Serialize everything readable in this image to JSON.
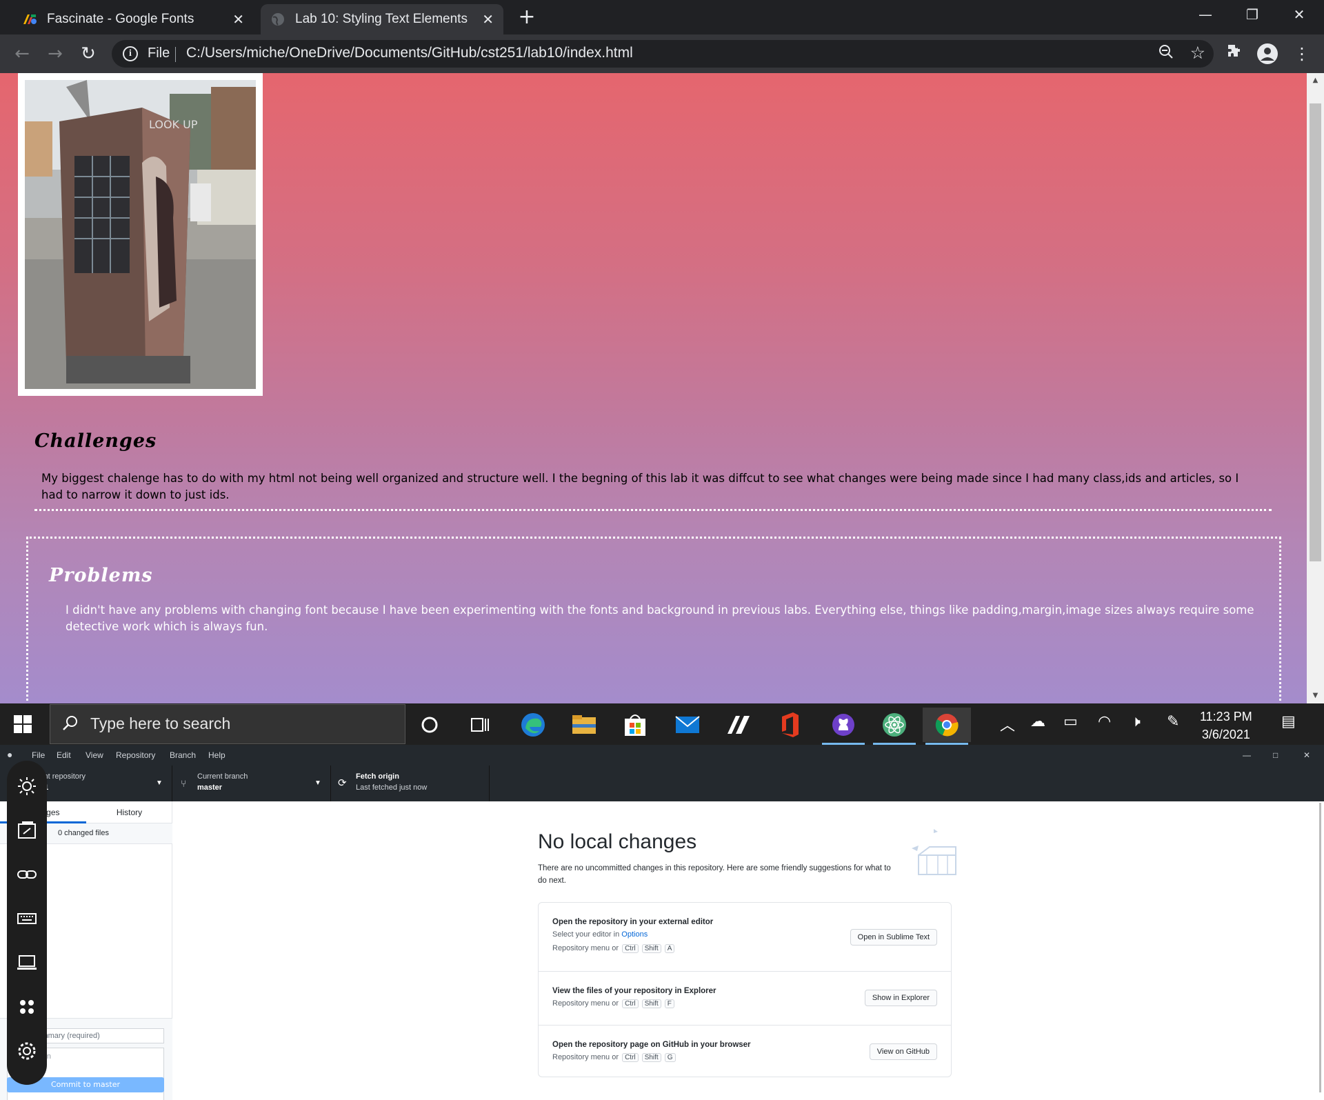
{
  "browser": {
    "tabs": [
      {
        "title": "Fascinate - Google Fonts",
        "favicon": "google-fonts-icon"
      },
      {
        "title": "Lab 10: Styling Text Elements",
        "favicon": "globe-icon"
      }
    ],
    "omnibox": {
      "scheme_label": "File",
      "url": "C:/Users/miche/OneDrive/Documents/GitHub/cst251/lab10/index.html"
    }
  },
  "page": {
    "challenges": {
      "heading": "Challenges",
      "text": "My biggest chalenge has to do with my html not being well organized and structure well. I the begning of this lab it was diffcut to see what changes were being made since I had many class,ids and articles, so I had to narrow it down to just ids."
    },
    "problems": {
      "heading": "Problems",
      "text": "I didn't have any problems with changing font because I have been experimenting with the fonts and background in previous labs. Everything else, things like padding,margin,image sizes always require some detective work which is always fun."
    },
    "colors": {
      "gradient_top": "#e5666e",
      "gradient_bottom": "#a48ccc"
    }
  },
  "taskbar": {
    "search_placeholder": "Type here to search",
    "time": "11:23 PM",
    "date": "3/6/2021",
    "apps": [
      "cortana-icon",
      "task-view-icon",
      "edge-icon",
      "file-explorer-icon",
      "store-icon",
      "mail-icon",
      "app-icon",
      "office-icon",
      "github-desktop-icon",
      "atom-icon",
      "chrome-icon"
    ]
  },
  "github_desktop": {
    "menu": [
      "File",
      "Edit",
      "View",
      "Repository",
      "Branch",
      "Help"
    ],
    "repo_label": "Current repository",
    "repo_value": "cst251",
    "branch_label": "Current branch",
    "branch_value": "master",
    "fetch_label": "Fetch origin",
    "fetch_sub": "Last fetched just now",
    "tab_changes": "Changes",
    "tab_history": "History",
    "changed_files": "0 changed files",
    "summary_placeholder": "Summary (required)",
    "description_placeholder": "Description",
    "commit_button": "Commit to master",
    "no_changes_title": "No local changes",
    "no_changes_text": "There are no uncommitted changes in this repository. Here are some friendly suggestions for what to do next.",
    "suggestions": [
      {
        "title": "Open the repository in your external editor",
        "sub_prefix": "Select your editor in ",
        "sub_link": "Options",
        "shortcut_prefix": "Repository menu or",
        "keys": [
          "Ctrl",
          "Shift",
          "A"
        ],
        "button": "Open in Sublime Text"
      },
      {
        "title": "View the files of your repository in Explorer",
        "shortcut_prefix": "Repository menu or",
        "keys": [
          "Ctrl",
          "Shift",
          "F"
        ],
        "button": "Show in Explorer"
      },
      {
        "title": "Open the repository page on GitHub in your browser",
        "shortcut_prefix": "Repository menu or",
        "keys": [
          "Ctrl",
          "Shift",
          "G"
        ],
        "button": "View on GitHub"
      }
    ]
  }
}
